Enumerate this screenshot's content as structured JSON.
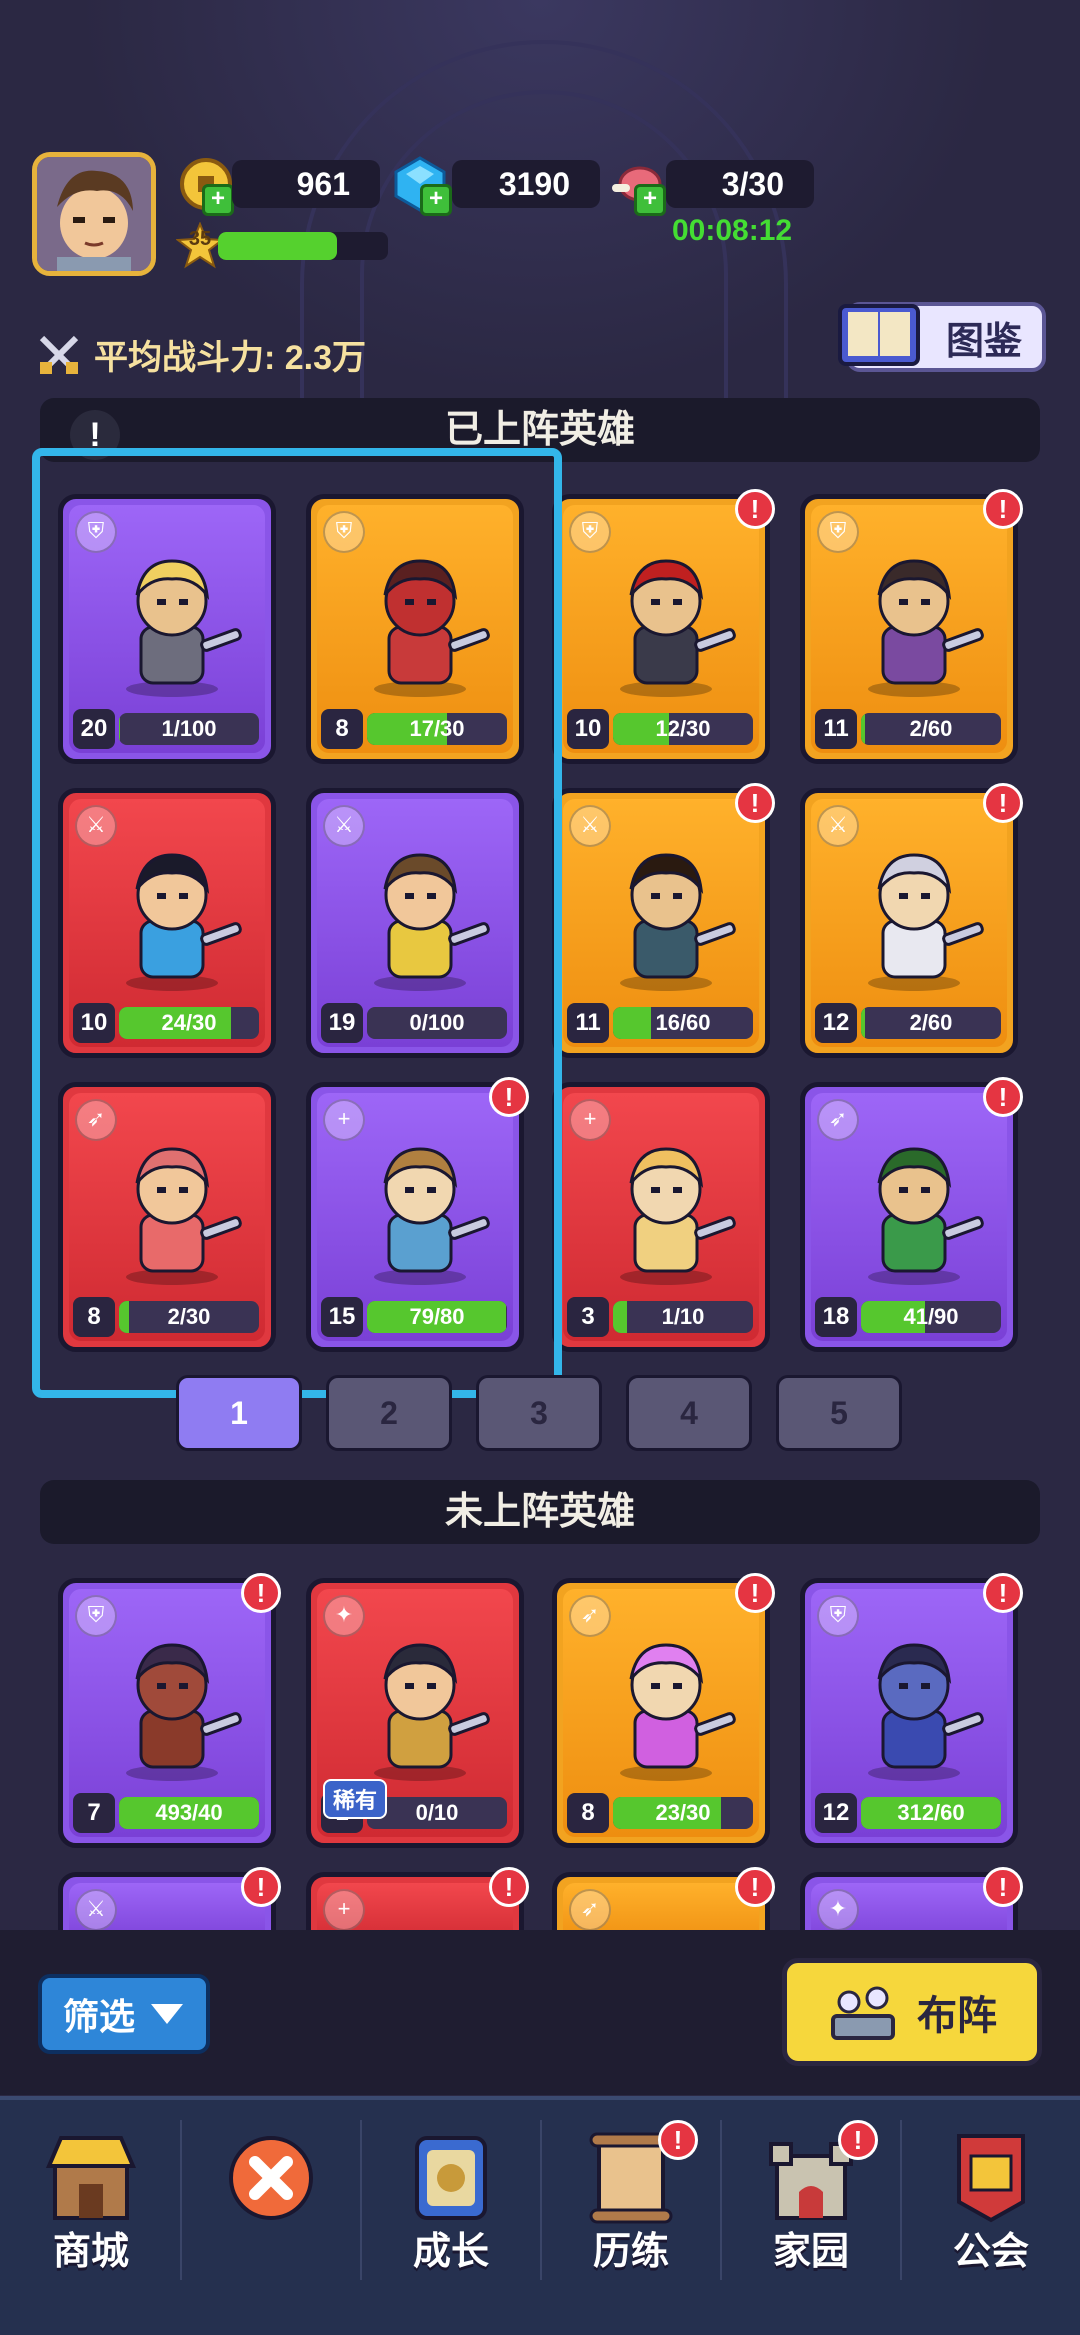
{
  "resources": {
    "coins": "961",
    "gems": "3190",
    "stamina": "3/30",
    "stamina_timer": "00:08:12"
  },
  "player": {
    "level": "35",
    "xp_fraction": 0.7
  },
  "power": {
    "label": "平均战斗力: 2.3万"
  },
  "codex": {
    "label": "图鉴"
  },
  "sections": {
    "deployed": "已上阵英雄",
    "undeployed": "未上阵英雄"
  },
  "deployed_heroes": [
    {
      "level": "20",
      "shards": "1/100",
      "progress": 0.01,
      "color": "purple",
      "cls": "shield",
      "alert": false
    },
    {
      "level": "8",
      "shards": "17/30",
      "progress": 0.57,
      "color": "orange",
      "cls": "shield",
      "alert": false
    },
    {
      "level": "10",
      "shards": "12/30",
      "progress": 0.4,
      "color": "orange",
      "cls": "shield",
      "alert": true
    },
    {
      "level": "11",
      "shards": "2/60",
      "progress": 0.03,
      "color": "orange",
      "cls": "shield",
      "alert": true
    },
    {
      "level": "10",
      "shards": "24/30",
      "progress": 0.8,
      "color": "red",
      "cls": "sword",
      "alert": false
    },
    {
      "level": "19",
      "shards": "0/100",
      "progress": 0.0,
      "color": "purple",
      "cls": "sword",
      "alert": false
    },
    {
      "level": "11",
      "shards": "16/60",
      "progress": 0.27,
      "color": "orange",
      "cls": "sword",
      "alert": true
    },
    {
      "level": "12",
      "shards": "2/60",
      "progress": 0.03,
      "color": "orange",
      "cls": "sword",
      "alert": true
    },
    {
      "level": "8",
      "shards": "2/30",
      "progress": 0.07,
      "color": "red",
      "cls": "bow",
      "alert": false
    },
    {
      "level": "15",
      "shards": "79/80",
      "progress": 0.99,
      "color": "purple",
      "cls": "plus",
      "alert": true
    },
    {
      "level": "3",
      "shards": "1/10",
      "progress": 0.1,
      "color": "red",
      "cls": "plus",
      "alert": false
    },
    {
      "level": "18",
      "shards": "41/90",
      "progress": 0.46,
      "color": "purple",
      "cls": "bow",
      "alert": true
    }
  ],
  "pages": [
    "1",
    "2",
    "3",
    "4",
    "5"
  ],
  "undeployed_heroes": [
    {
      "level": "7",
      "shards": "493/40",
      "progress": 1.0,
      "color": "purple",
      "cls": "shield",
      "alert": true,
      "tag": ""
    },
    {
      "level": "1",
      "shards": "0/10",
      "progress": 0.0,
      "color": "red",
      "cls": "magic",
      "alert": false,
      "tag": "稀有"
    },
    {
      "level": "8",
      "shards": "23/30",
      "progress": 0.77,
      "color": "orange",
      "cls": "bow",
      "alert": true,
      "tag": ""
    },
    {
      "level": "12",
      "shards": "312/60",
      "progress": 1.0,
      "color": "purple",
      "cls": "shield",
      "alert": true,
      "tag": ""
    }
  ],
  "partial_row": [
    {
      "color": "purple",
      "cls": "sword",
      "alert": true
    },
    {
      "color": "red",
      "cls": "plus",
      "alert": true
    },
    {
      "color": "orange",
      "cls": "bow",
      "alert": true
    },
    {
      "color": "purple",
      "cls": "magic",
      "alert": true
    }
  ],
  "actions": {
    "filter": "筛选",
    "deploy": "布阵"
  },
  "nav": [
    {
      "label": "商城",
      "icon": "shop-icon",
      "alert": false
    },
    {
      "label": "",
      "icon": "close-icon",
      "alert": false
    },
    {
      "label": "成长",
      "icon": "growth-icon",
      "alert": false
    },
    {
      "label": "历练",
      "icon": "scroll-map-icon",
      "alert": true
    },
    {
      "label": "家园",
      "icon": "castle-icon",
      "alert": true
    },
    {
      "label": "公会",
      "icon": "guild-banner-icon",
      "alert": false
    }
  ],
  "colors": {
    "purple": "#8a55e8",
    "orange": "#f2a320",
    "red": "#e0383f",
    "highlight": "#33b6ea",
    "progress": "#56c72e"
  }
}
